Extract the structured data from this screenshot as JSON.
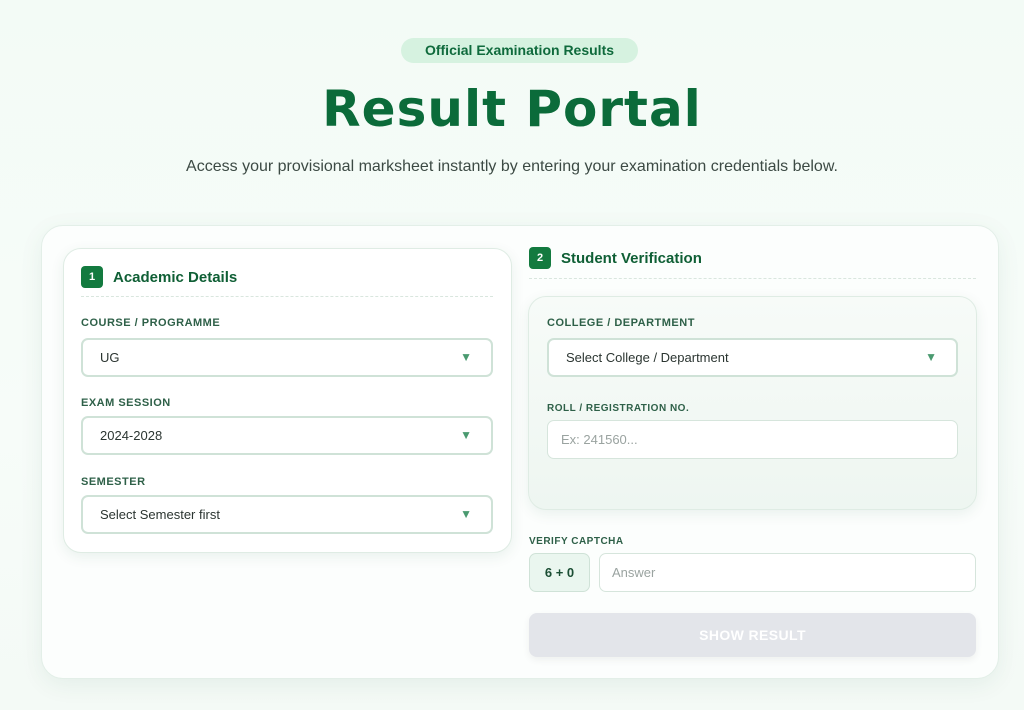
{
  "hero": {
    "badge": "Official Examination Results",
    "title": "Result Portal",
    "subtitle": "Access your provisional marksheet instantly by entering your examination credentials below."
  },
  "academic": {
    "step": "1",
    "title": "Academic Details",
    "course_label": "COURSE / PROGRAMME",
    "course_value": "UG",
    "session_label": "EXAM SESSION",
    "session_value": "2024-2028",
    "semester_label": "SEMESTER",
    "semester_value": "Select Semester first"
  },
  "verification": {
    "step": "2",
    "title": "Student Verification",
    "college_label": "COLLEGE / DEPARTMENT",
    "college_value": "Select College / Department",
    "roll_label": "ROLL / REGISTRATION NO.",
    "roll_placeholder": "Ex: 241560...",
    "captcha_label": "VERIFY CAPTCHA",
    "captcha_question": "6 + 0",
    "captcha_placeholder": "Answer",
    "submit_label": "SHOW RESULT"
  },
  "icons": {
    "select_caret": "chevron-down-icon",
    "caret_glyph": "▼"
  },
  "colors": {
    "brand": "#0b6b3a",
    "step_badge": "#137a3f",
    "badge_bg": "#d6f2e0",
    "submit_disabled": "#e3e5ea"
  }
}
